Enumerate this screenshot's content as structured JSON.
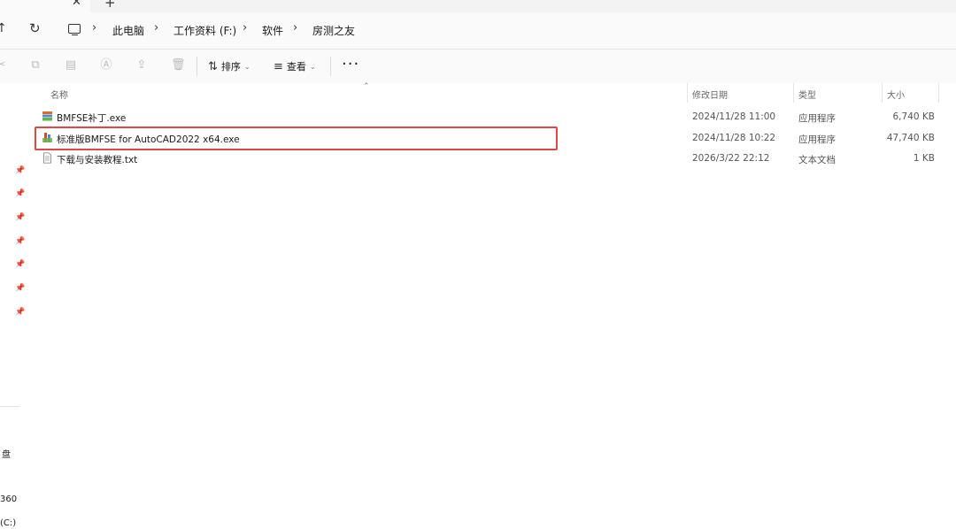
{
  "tabs": {
    "new_tab_glyph": "+",
    "close_glyph": "✕"
  },
  "breadcrumb": [
    "此电脑",
    "工作资料 (F:)",
    "软件",
    "房测之友"
  ],
  "toolbar": {
    "sort_label": "排序",
    "view_label": "查看",
    "more_label": "···"
  },
  "columns": {
    "name": "名称",
    "date": "修改日期",
    "type": "类型",
    "size": "大小"
  },
  "files": [
    {
      "name": "BMFSE补丁.exe",
      "date": "2024/11/28 11:00",
      "type": "应用程序",
      "size": "6,740 KB",
      "icon": "installer-icon"
    },
    {
      "name": "标准版BMFSE for AutoCAD2022 x64.exe",
      "date": "2024/11/28 10:22",
      "type": "应用程序",
      "size": "47,740 KB",
      "icon": "installer-icon"
    },
    {
      "name": "下载与安装教程.txt",
      "date": "2026/3/22 22:12",
      "type": "文本文档",
      "size": "1 KB",
      "icon": "text-file-icon"
    }
  ],
  "sidebar": {
    "drive_fragment": "盘",
    "num_fragment": "360",
    "c_fragment": "(C:)"
  },
  "colors": {
    "highlight": "#e04848",
    "accent": "#0067c0"
  }
}
